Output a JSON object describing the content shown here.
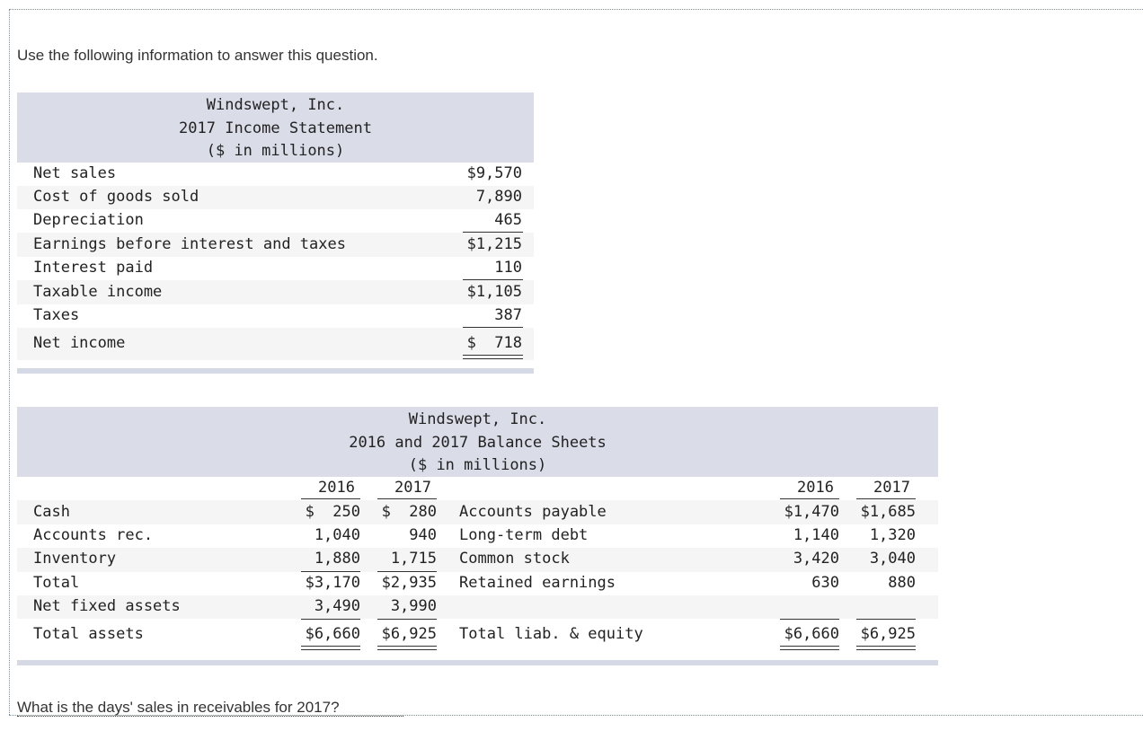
{
  "intro": "Use the following information to answer this question.",
  "income_statement": {
    "title": [
      "Windswept, Inc.",
      "2017 Income Statement",
      "($ in millions)"
    ],
    "rows": [
      {
        "label": "Net sales",
        "value": "$9,570"
      },
      {
        "label": "Cost of goods sold",
        "value": "7,890"
      },
      {
        "label": "Depreciation",
        "value": "465"
      },
      {
        "label": "Earnings before interest and taxes",
        "value": "$1,215"
      },
      {
        "label": "Interest paid",
        "value": "110"
      },
      {
        "label": "Taxable income",
        "value": "$1,105"
      },
      {
        "label": "Taxes",
        "value": "387"
      },
      {
        "label": "Net income",
        "value": "$  718"
      }
    ]
  },
  "balance_sheet": {
    "title": [
      "Windswept, Inc.",
      "2016 and 2017 Balance Sheets",
      "($ in millions)"
    ],
    "years": [
      "2016",
      "2017"
    ],
    "assets": [
      {
        "label": "Cash",
        "y2016": "$  250",
        "y2017": "$  280"
      },
      {
        "label": "Accounts rec.",
        "y2016": "1,040",
        "y2017": "940"
      },
      {
        "label": "Inventory",
        "y2016": "1,880",
        "y2017": "1,715"
      },
      {
        "label": "Total",
        "y2016": "$3,170",
        "y2017": "$2,935"
      },
      {
        "label": "Net fixed assets",
        "y2016": "3,490",
        "y2017": "3,990"
      },
      {
        "label": "Total assets",
        "y2016": "$6,660",
        "y2017": "$6,925"
      }
    ],
    "liabilities": [
      {
        "label": "Accounts payable",
        "y2016": "$1,470",
        "y2017": "$1,685"
      },
      {
        "label": "Long-term debt",
        "y2016": "1,140",
        "y2017": "1,320"
      },
      {
        "label": "Common stock",
        "y2016": "3,420",
        "y2017": "3,040"
      },
      {
        "label": "Retained earnings",
        "y2016": "630",
        "y2017": "880"
      },
      {
        "label": "Total liab. & equity",
        "y2016": "$6,660",
        "y2017": "$6,925"
      }
    ]
  },
  "question": "What is the days' sales in receivables for 2017?"
}
